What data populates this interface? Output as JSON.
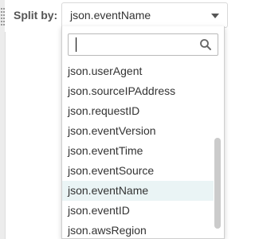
{
  "split": {
    "label": "Split by:",
    "selected_value": "json.eventName"
  },
  "dropdown": {
    "search": {
      "value": "",
      "placeholder": ""
    },
    "options": [
      "json.userAgent",
      "json.sourceIPAddress",
      "json.requestID",
      "json.eventVersion",
      "json.eventTime",
      "json.eventSource",
      "json.eventName",
      "json.eventID",
      "json.awsRegion"
    ],
    "selected_index": 6
  },
  "colors": {
    "selected_row": "#eaf4f5",
    "text": "#333333",
    "label": "#555555"
  },
  "icons": {
    "search": "search-icon",
    "caret": "chevron-down-icon",
    "grip": "drag-handle-icon"
  }
}
